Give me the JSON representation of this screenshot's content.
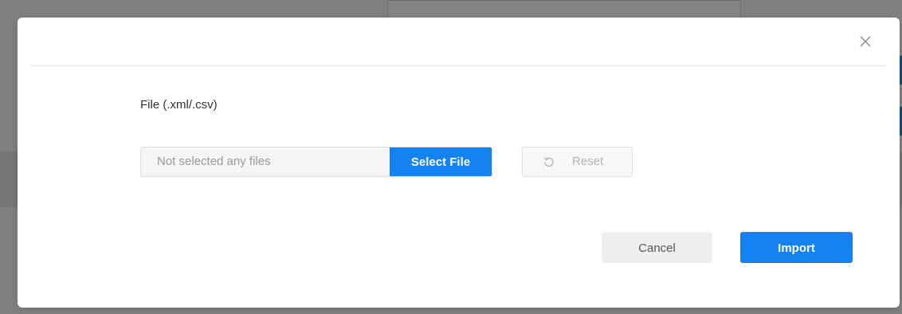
{
  "dialog": {
    "close_icon": "close-icon",
    "field_label": "File (.xml/.csv)",
    "file_input": {
      "placeholder": "Not selected any files",
      "select_label": "Select File"
    },
    "reset": {
      "label": "Reset",
      "icon": "reset-icon",
      "disabled": true
    },
    "footer": {
      "cancel_label": "Cancel",
      "import_label": "Import"
    }
  },
  "colors": {
    "primary": "#1482f0",
    "overlay": "#808080",
    "disabled_text": "#b4b4b4"
  }
}
